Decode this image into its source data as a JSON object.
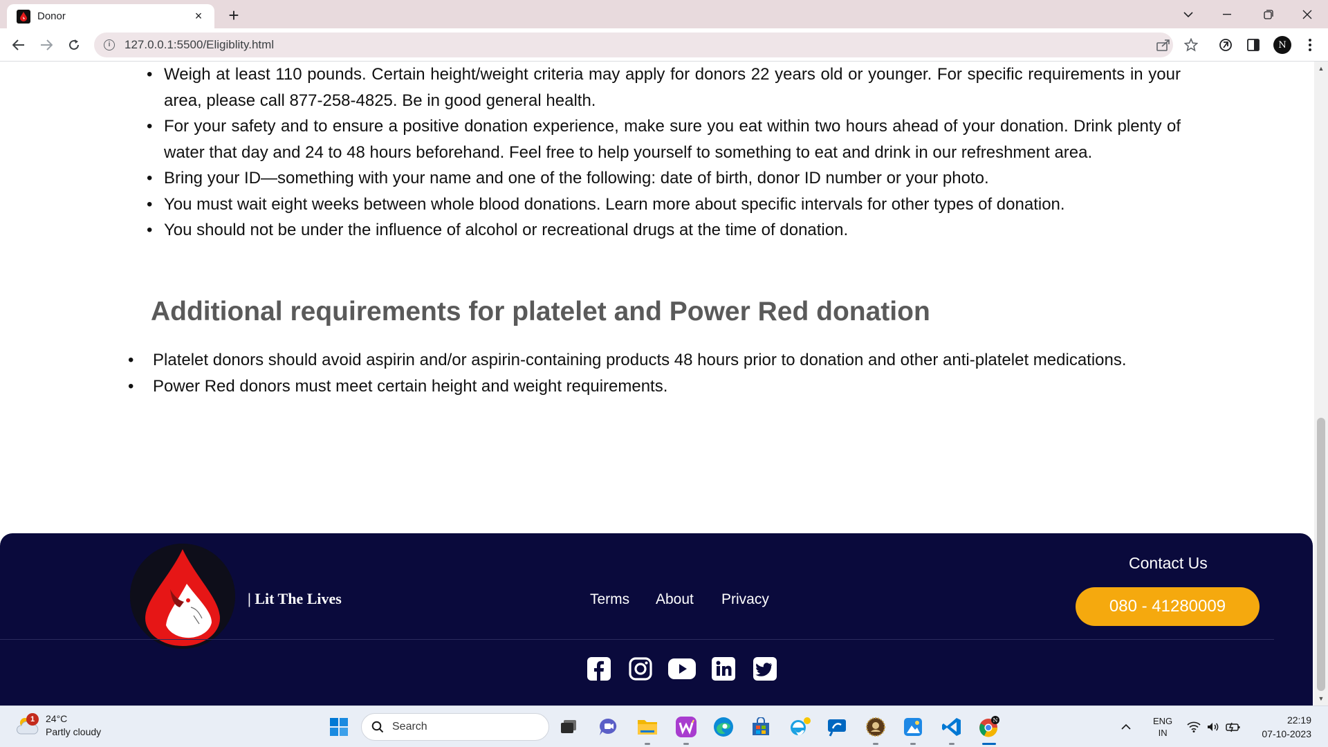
{
  "browser": {
    "tab_title": "Donor",
    "tab_close": "×",
    "new_tab": "+",
    "url": "127.0.0.1:5500/Eligiblity.html"
  },
  "eligibility_list": [
    "Weigh at least 110 pounds. Certain height/weight criteria may apply for donors 22 years old or younger. For specific requirements in your area, please call 877-258-4825. Be in good general health.",
    "For your safety and to ensure a positive donation experience, make sure you eat within two hours ahead of your donation. Drink plenty of water that day and 24 to 48 hours beforehand. Feel free to help yourself to something to eat and drink in our refreshment area.",
    "Bring your ID—something with your name and one of the following: date of birth, donor ID number or your photo.",
    "You must wait eight weeks between whole blood donations. Learn more about specific intervals for other types of donation.",
    "You should not be under the influence of alcohol or recreational drugs at the time of donation."
  ],
  "additional": {
    "heading": "Additional requirements for platelet and Power Red donation",
    "items": [
      "Platelet donors should avoid aspirin and/or aspirin-containing products 48 hours prior to donation and other anti-platelet medications.",
      "Power Red donors must meet certain height and weight requirements."
    ]
  },
  "footer": {
    "tagline": "| Lit The Lives",
    "links": [
      "Terms",
      "About",
      "Privacy"
    ],
    "contact_title": "Contact Us",
    "phone": "080 - 41280009",
    "socials": [
      "facebook-icon",
      "instagram-icon",
      "youtube-icon",
      "linkedin-icon",
      "twitter-icon"
    ]
  },
  "taskbar": {
    "weather_badge": "1",
    "temperature": "24°C",
    "condition": "Partly cloudy",
    "search_label": "Search",
    "lang_top": "ENG",
    "lang_bottom": "IN",
    "time": "22:19",
    "date": "07-10-2023"
  },
  "colors": {
    "footer_bg": "#0a0a3c",
    "phone_button": "#f5a90e",
    "heading": "#5a5a5a"
  }
}
